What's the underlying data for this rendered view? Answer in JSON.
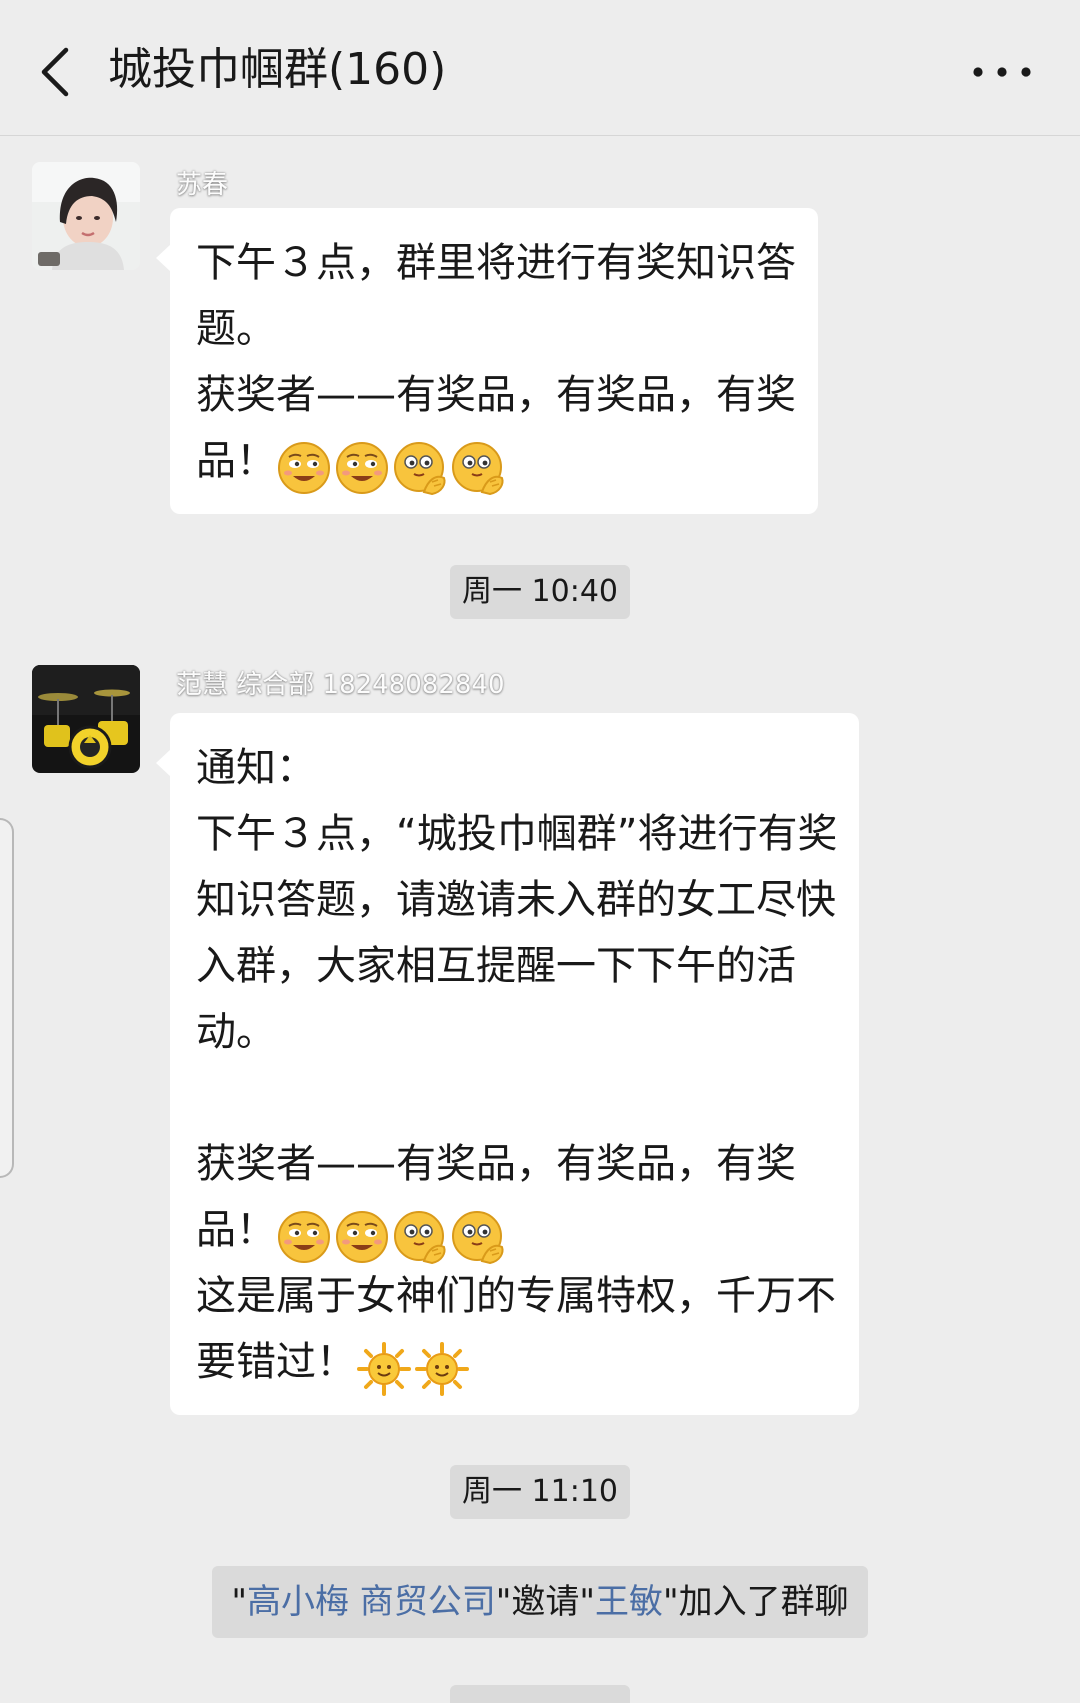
{
  "header": {
    "title": "城投巾帼群(160)"
  },
  "messages": [
    {
      "sender": "苏春",
      "lines": [
        "下午３点，群里将进行有奖知识答",
        "题。",
        "获奖者——有奖品，有奖品，有奖"
      ],
      "last_line": "品！",
      "emojis": [
        "grin-face-icon",
        "grin-face-icon",
        "peek-face-icon",
        "peek-face-icon"
      ]
    },
    {
      "sender": "范慧 综合部 18248082840",
      "lines": [
        "通知：",
        "下午３点，“城投巾帼群”将进行有奖",
        "知识答题，请邀请未入群的女工尽快",
        "入群，大家相互提醒一下下午的活",
        "动。",
        "",
        "获奖者——有奖品，有奖品，有奖"
      ],
      "emoji_line": "品！",
      "emojis": [
        "grin-face-icon",
        "grin-face-icon",
        "peek-face-icon",
        "peek-face-icon"
      ],
      "line_after": "这是属于女神们的专属特权，千万不",
      "last_line": "要错过！",
      "end_emojis": [
        "sun-icon",
        "sun-icon"
      ]
    }
  ],
  "timestamps": [
    "周一 10:40",
    "周一 11:10"
  ],
  "system": {
    "q1": "\"",
    "inviter": "高小梅 商贸公司",
    "mid": "\"邀请\"",
    "invitee": "王敏",
    "tail": "\"加入了群聊"
  },
  "colors": {
    "background": "#ededed",
    "bubble": "#ffffff",
    "chip": "#dadada",
    "link": "#4b6ea5"
  }
}
